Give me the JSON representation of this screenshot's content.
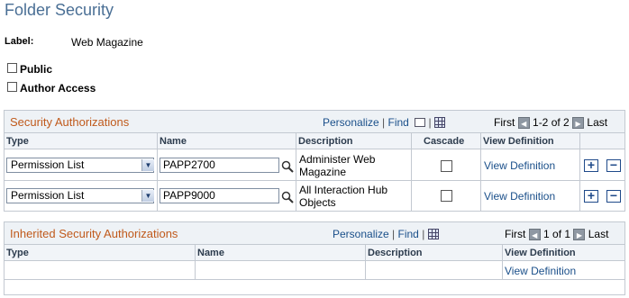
{
  "page": {
    "title": "Folder Security"
  },
  "label": {
    "caption": "Label:",
    "value": "Web Magazine"
  },
  "checkboxes": {
    "public": "Public",
    "author_access": "Author Access"
  },
  "grid_nav": {
    "personalize": "Personalize",
    "find": "Find",
    "sep": "|",
    "first": "First",
    "last": "Last"
  },
  "security_grid": {
    "title": "Security Authorizations",
    "range": "1-2 of 2",
    "columns": {
      "type": "Type",
      "name": "Name",
      "description": "Description",
      "cascade": "Cascade",
      "view_definition": "View Definition"
    },
    "rows": [
      {
        "type": "Permission List",
        "name": "PAPP2700",
        "description_line1": "Administer Web",
        "description_line2": "Magazine",
        "cascade": false,
        "view_definition": "View Definition"
      },
      {
        "type": "Permission List",
        "name": "PAPP9000",
        "description_line1": "All Interaction Hub",
        "description_line2": "Objects",
        "cascade": false,
        "view_definition": "View Definition"
      }
    ],
    "add": "+",
    "remove": "−"
  },
  "inherited_grid": {
    "title": "Inherited Security Authorizations",
    "range": "1 of 1",
    "columns": {
      "type": "Type",
      "name": "Name",
      "description": "Description",
      "view_definition": "View Definition"
    },
    "rows": [
      {
        "view_definition": "View Definition"
      }
    ]
  },
  "icons": {
    "zoom": "zoom-icon",
    "download": "download-icon",
    "prev": "prev-arrow-icon",
    "next": "next-arrow-icon",
    "lookup": "lookup-icon",
    "dropdown": "chevron-down-icon"
  }
}
